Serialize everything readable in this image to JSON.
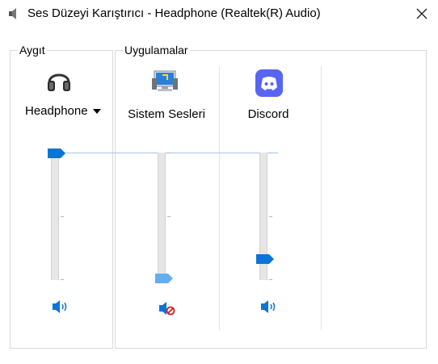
{
  "window": {
    "title": "Ses Düzeyi Karıştırıcı - Headphone (Realtek(R) Audio)"
  },
  "device_group": {
    "label": "Aygıt",
    "device_name": "Headphone",
    "device_icon": "headphones-icon",
    "volume_percent": 100,
    "muted": false
  },
  "apps_group": {
    "label": "Uygulamalar",
    "apps": [
      {
        "label": "Sistem Sesleri",
        "icon": "system-sounds-icon",
        "volume_percent": 0,
        "muted": true
      },
      {
        "label": "Discord",
        "icon": "discord-icon",
        "volume_percent": 15,
        "muted": false
      }
    ]
  },
  "colors": {
    "accent": "#0b74d6",
    "accent_light": "#63aef0",
    "muted_red": "#d01f1f"
  }
}
